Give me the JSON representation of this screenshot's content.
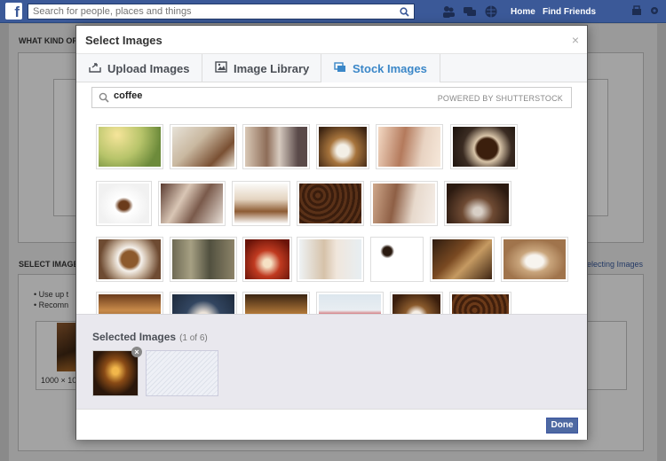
{
  "topbar": {
    "logo": "f",
    "search_placeholder": "Search for people, places and things",
    "home_label": "Home",
    "find_friends_label": "Find Friends"
  },
  "background": {
    "heading1": "WHAT KIND OF",
    "heading2": "SELECT IMAGES",
    "bullet1": "• Use up t",
    "bullet2": "• Recomn",
    "size_label": "1000 × 10",
    "link": "electing Images"
  },
  "modal": {
    "title": "Select Images",
    "close": "×",
    "tabs": [
      {
        "label": "Upload Images",
        "icon": "upload-icon"
      },
      {
        "label": "Image Library",
        "icon": "image-library-icon"
      },
      {
        "label": "Stock Images",
        "icon": "stock-images-icon",
        "active": true
      }
    ],
    "search_value": "coffee",
    "powered_by": "POWERED BY SHUTTERSTOCK",
    "images": [
      {
        "desc": "iced coffee glass in sunlight"
      },
      {
        "desc": "coffee cups and pastries"
      },
      {
        "desc": "friends chatting over coffee"
      },
      {
        "desc": "cup of coffee in cafe"
      },
      {
        "desc": "woman sipping coffee"
      },
      {
        "desc": "top view black coffee"
      },
      {
        "desc": "white espresso cup"
      },
      {
        "desc": "hands holding cups"
      },
      {
        "desc": "latte cups and beans"
      },
      {
        "desc": "coffee beans texture"
      },
      {
        "desc": "woman with mug by window"
      },
      {
        "desc": "steaming cup on dark"
      },
      {
        "desc": "latte art heart"
      },
      {
        "desc": "people in coffee shop"
      },
      {
        "desc": "red cup with splash"
      },
      {
        "desc": "smiling woman with mug"
      },
      {
        "desc": "cups set on white"
      },
      {
        "desc": "beans spilled from sack"
      },
      {
        "desc": "latte cup on wood"
      },
      {
        "desc": "cafe interior"
      },
      {
        "desc": "hands holding latte"
      },
      {
        "desc": "warm coffee glow"
      },
      {
        "desc": "red mug on table"
      },
      {
        "desc": "cup with steam"
      },
      {
        "desc": "roasted beans closeup"
      }
    ],
    "selected": {
      "title": "Selected Images",
      "count": "(1 of 6)",
      "remove": "×"
    },
    "done_label": "Done"
  },
  "colors": {
    "brand": "#3b5998",
    "active_tab": "#3b87c8",
    "done": "#4e69a2"
  }
}
